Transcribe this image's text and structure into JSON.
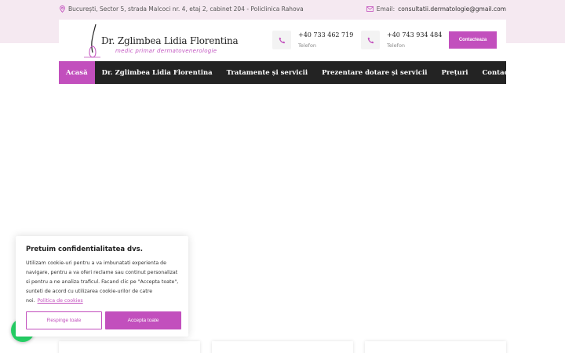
{
  "topbar": {
    "address": "București, Sector 5, strada Malcoci nr. 4, etaj 2, cabinet 204 - Policlinica Rahova",
    "email_label": "Email:",
    "email": "consultatii.dermatologie@gmail.com"
  },
  "header": {
    "logo_name": "Dr. Zglimbea Lidia Florentina",
    "logo_subtitle": "medic primar dermatovenerologie",
    "phones": [
      {
        "number": "+40 733 462 719",
        "label": "Telefon"
      },
      {
        "number": "+40 743 934 484",
        "label": "Telefon"
      }
    ],
    "cta_label": "Contacteaza"
  },
  "nav": {
    "items": [
      {
        "label": "Acasă"
      },
      {
        "label": "Dr. Zglimbea Lidia Florentina"
      },
      {
        "label": "Tratamente și servicii"
      },
      {
        "label": "Prezentare dotare și servicii"
      },
      {
        "label": "Prețuri"
      },
      {
        "label": "Contact"
      }
    ]
  },
  "cookie": {
    "title": "Pretuim confidentialitatea dvs.",
    "body": "Utilizam cookie-uri pentru a va imbunatati experienta de navigare, pentru a va oferi reclame sau continut personalizat si pentru a ne analiza traficul. Facand clic pe \"Accepta toate\", sunteti de acord cu utilizarea cookie-urilor de catre noi.",
    "policy_link": "Politica de cookies",
    "reject_label": "Respinge toate",
    "accept_label": "Accepta toate"
  },
  "colors": {
    "accent": "#c24fbd",
    "nav_bg": "#232323",
    "topbar_bg": "#f5e9f1",
    "whatsapp": "#25d366"
  },
  "icons": {
    "address": "map-pin-icon",
    "email": "envelope-icon",
    "phone": "phone-icon",
    "whatsapp": "whatsapp-icon"
  }
}
